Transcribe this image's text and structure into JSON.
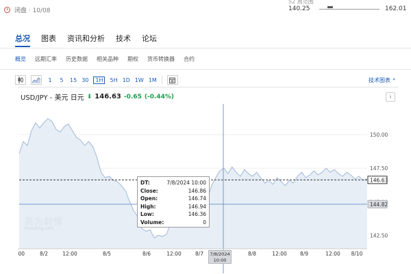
{
  "status": {
    "text": "闭盘 · 10/08"
  },
  "range52": {
    "label": "52 周范围",
    "low": "140.25",
    "high": "162.01"
  },
  "main_tabs": [
    {
      "label": "总况",
      "active": true
    },
    {
      "label": "图表"
    },
    {
      "label": "资讯和分析"
    },
    {
      "label": "技术"
    },
    {
      "label": "论坛"
    }
  ],
  "sub_tabs": [
    {
      "label": "概览",
      "active": true
    },
    {
      "label": "远期汇率"
    },
    {
      "label": "历史数据"
    },
    {
      "label": "相关品种"
    },
    {
      "label": "期权"
    },
    {
      "label": "货币转换器"
    },
    {
      "label": "合约"
    }
  ],
  "toolbar": {
    "candle_icon": "candlestick-icon",
    "area_icon": "area-chart-icon",
    "intervals": [
      "1",
      "5",
      "15",
      "30",
      "1H",
      "5H",
      "1D",
      "1W",
      "1M"
    ],
    "active_interval": "1H",
    "calendar_icon": "calendar-icon",
    "tech_link": "技术图表",
    "tech_arrow": "»"
  },
  "header": {
    "symbol": "USD/JPY - 美元 日元",
    "arrow": "⬇",
    "price": "146.63",
    "change": "-0.65",
    "change_pct": "(-0.44%)",
    "info": "i"
  },
  "tooltip": {
    "rows": [
      {
        "k": "DT:",
        "v": "7/8/2024 10:00"
      },
      {
        "k": "Close:",
        "v": "146.86"
      },
      {
        "k": "Open:",
        "v": "146.74"
      },
      {
        "k": "High:",
        "v": "146.94"
      },
      {
        "k": "Low:",
        "v": "146.36"
      },
      {
        "k": "Volume:",
        "v": "0"
      }
    ]
  },
  "logo": {
    "cn": "英为财情",
    "en": "Investing.com"
  },
  "cursor_tag": {
    "date": "7/8/2024",
    "time": "10:00"
  },
  "colors": {
    "accent": "#1a5bb5",
    "positive": "#1a9d4b",
    "area": "#e8eef6",
    "line": "#9fb8d6"
  },
  "chart_data": {
    "type": "area",
    "yticks": [
      "150.00",
      "147.50",
      "145.00",
      "142.50"
    ],
    "xticks": [
      ":00",
      "8/2",
      "12:00",
      "8/5",
      "8/6",
      "12:00",
      "8/7",
      "8/8",
      "12:00",
      "8/9",
      "12:00",
      "8/10"
    ],
    "ylim": [
      141.5,
      152.3
    ],
    "last_price_label": "146.63",
    "crosshair_price_label": "144.82",
    "values": [
      148.6,
      149.5,
      149.2,
      150.3,
      150.9,
      150.5,
      150.9,
      151.2,
      151.0,
      150.4,
      150.2,
      150.6,
      150.8,
      150.3,
      149.8,
      149.6,
      149.2,
      149.5,
      149.1,
      148.3,
      147.2,
      146.8,
      146.9,
      146.6,
      146.5,
      146.2,
      145.8,
      145.0,
      144.3,
      143.9,
      143.0,
      142.8,
      142.9,
      142.3,
      142.5,
      142.4,
      142.6,
      143.4,
      143.8,
      144.3,
      144.4,
      144.2,
      144.6,
      144.7,
      144.5,
      144.9,
      145.2,
      146.2,
      146.8,
      147.3,
      147.5,
      147.1,
      147.6,
      147.2,
      146.9,
      147.4,
      147.1,
      146.9,
      147.2,
      146.8,
      146.4,
      146.6,
      146.3,
      146.8,
      146.5,
      146.2,
      146.6,
      146.4,
      146.9,
      147.2,
      146.8,
      147.0,
      147.3,
      147.0,
      147.2,
      147.5,
      147.2,
      147.4,
      147.1,
      146.9,
      147.2,
      147.0,
      146.7,
      146.9,
      146.6,
      146.7
    ]
  }
}
